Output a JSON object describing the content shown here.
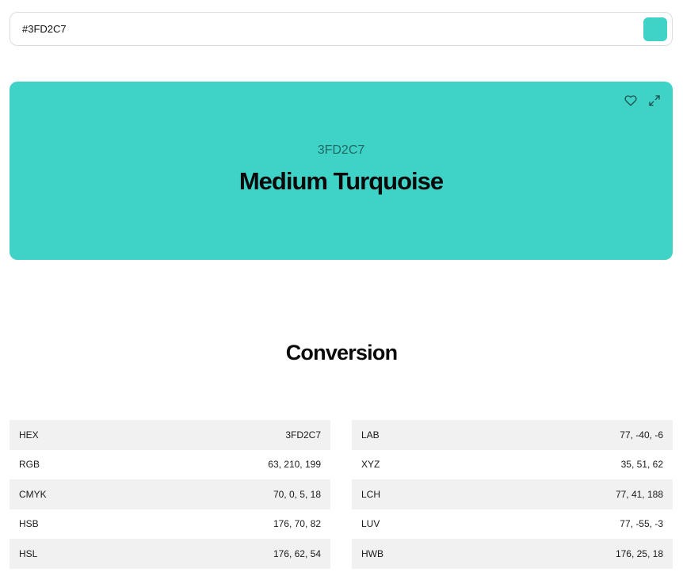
{
  "search": {
    "value": "#3FD2C7",
    "swatch_color": "#3FD2C7"
  },
  "colors": {
    "card_bg": "#3FD2C7"
  },
  "card": {
    "hex": "3FD2C7",
    "name": "Medium Turquoise",
    "actions": {
      "favorite_icon": "heart-icon",
      "fullscreen_icon": "expand-icon"
    }
  },
  "section": {
    "title": "Conversion"
  },
  "conversion": {
    "left": [
      {
        "label": "HEX",
        "value": "3FD2C7"
      },
      {
        "label": "RGB",
        "value": "63, 210, 199"
      },
      {
        "label": "CMYK",
        "value": "70, 0, 5, 18"
      },
      {
        "label": "HSB",
        "value": "176, 70, 82"
      },
      {
        "label": "HSL",
        "value": "176, 62, 54"
      }
    ],
    "right": [
      {
        "label": "LAB",
        "value": "77, -40, -6"
      },
      {
        "label": "XYZ",
        "value": "35, 51, 62"
      },
      {
        "label": "LCH",
        "value": "77, 41, 188"
      },
      {
        "label": "LUV",
        "value": "77, -55, -3"
      },
      {
        "label": "HWB",
        "value": "176, 25, 18"
      }
    ]
  }
}
